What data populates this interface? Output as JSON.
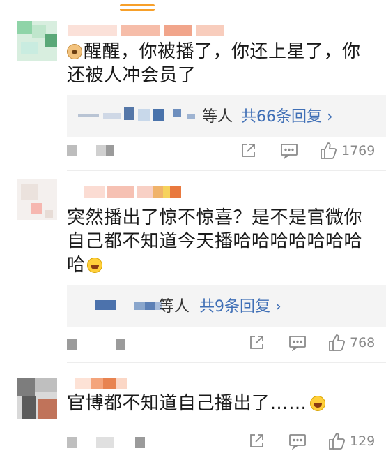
{
  "comments": [
    {
      "text": "醒醒，你被播了，你还上星了，你还被人冲会员了",
      "reply_summary": {
        "label": "等人",
        "link": "共66条回复 ›"
      },
      "likes": "1769"
    },
    {
      "text": "突然播出了惊不惊喜？是不是官微你自己都不知道今天播哈哈哈哈哈哈哈哈",
      "reply_summary": {
        "label": "等人",
        "link": "共9条回复 ›"
      },
      "likes": "768"
    },
    {
      "text": "官博都不知道自己播出了……",
      "likes": "129"
    }
  ],
  "icons": {
    "share": "share-icon",
    "comment": "comment-icon",
    "like": "thumbs-up-icon"
  },
  "colors": {
    "link": "#3f6fb6",
    "reply_bg": "#f4f4f4",
    "accent": "#f7a02a",
    "icon": "#888888"
  }
}
